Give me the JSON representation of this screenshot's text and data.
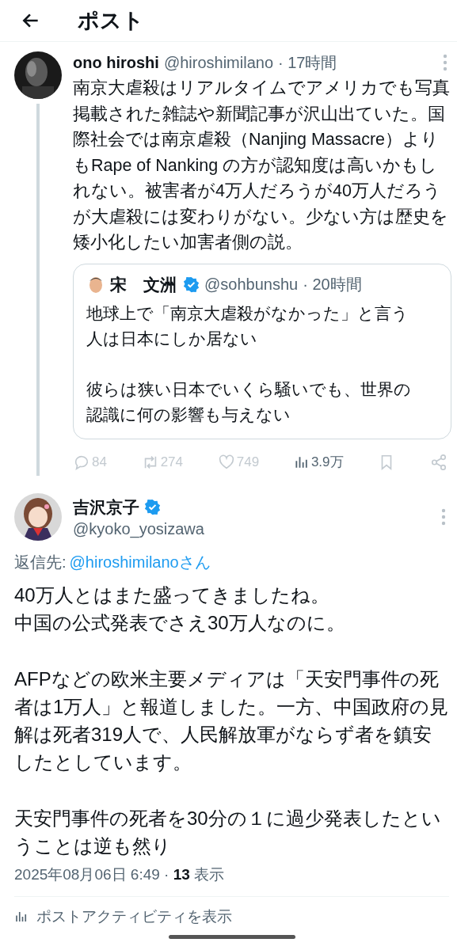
{
  "header": {
    "title": "ポスト"
  },
  "parent_post": {
    "author": "ono hiroshi",
    "handle": "@hiroshimilano",
    "time": "· 17時間",
    "text": "南京大虐殺はリアルタイムでアメリカでも写真掲載された雑誌や新聞記事が沢山出ていた。国際社会では南京虐殺（Nanjing Massacre）よりもRape of Nanking の方が認知度は高いかもしれない。被害者が4万人だろうが40万人だろうが大虐殺には変わりがない。少ない方は歴史を矮小化したい加害者側の説。",
    "quote": {
      "author": "宋　文洲",
      "verified": true,
      "handle": "@sohbunshu",
      "time": "· 20時間",
      "paragraphs": [
        "地球上で「南京大虐殺がなかった」と言う人は日本にしか居ない",
        "彼らは狭い日本でいくら騒いでも、世界の認識に何の影響も与えない"
      ]
    },
    "stats": [
      {
        "kind": "reply",
        "count": "84"
      },
      {
        "kind": "repost",
        "count": "274"
      },
      {
        "kind": "like",
        "count": "749"
      },
      {
        "kind": "views",
        "count": "3.9万"
      },
      {
        "kind": "bookmark"
      },
      {
        "kind": "share"
      }
    ]
  },
  "post": {
    "author": "吉沢京子",
    "verified": true,
    "handle": "@kyoko_yosizawa",
    "reply_to_label": "返信先:",
    "reply_to": "@hiroshimilanoさん",
    "paragraphs": [
      [
        "40万人とはまた盛ってきましたね。",
        "中国の公式発表でさえ30万人なのに。"
      ],
      [
        "AFPなどの欧米主要メディアは「天安門事件の死者は1万人」と報道しました。一方、中国政府の見解は死者319人で、人民解放軍がならず者を鎮安したとしています。"
      ],
      [
        "天安門事件の死者を30分の１に過少発表したということは逆も然り"
      ]
    ],
    "meta": "2025年08月06日 6:49 · **13** 表示",
    "activity": "ポストアクティビティを表示"
  }
}
